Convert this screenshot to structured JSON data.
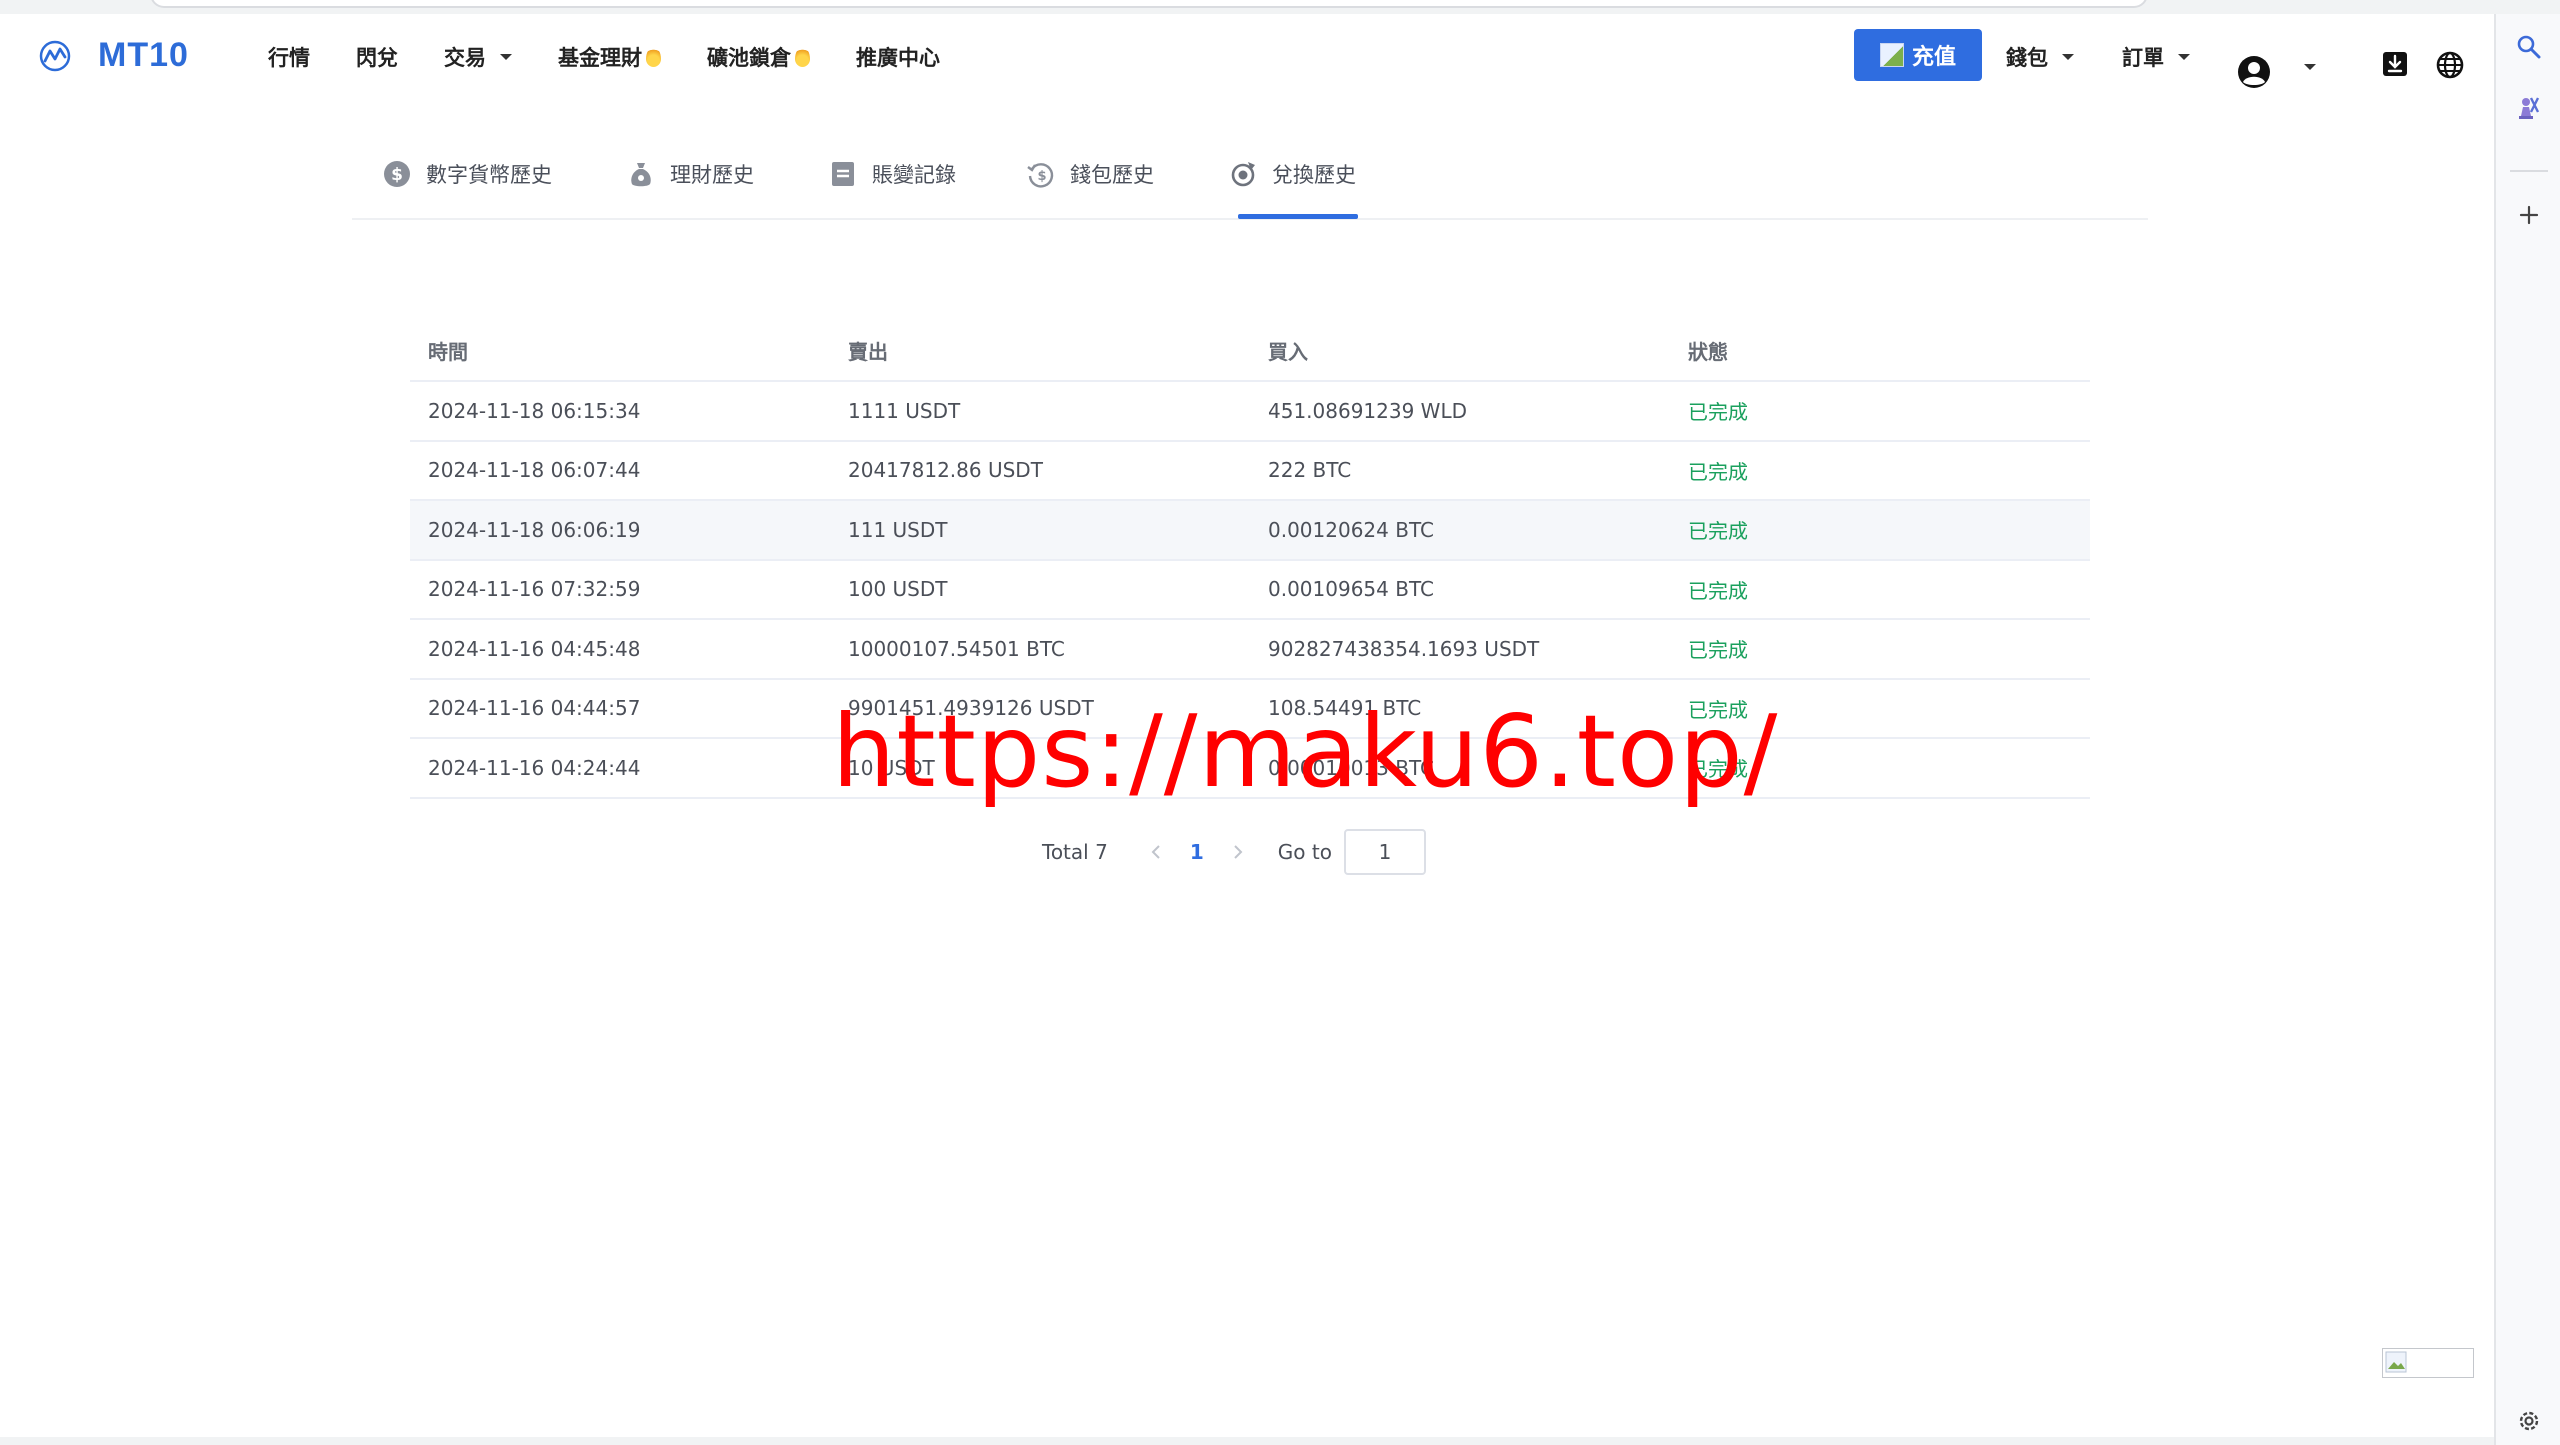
{
  "header": {
    "brand": "MT10",
    "nav": [
      {
        "label": "行情",
        "caret": false,
        "fire": false
      },
      {
        "label": "閃兌",
        "caret": false,
        "fire": false
      },
      {
        "label": "交易",
        "caret": true,
        "fire": false
      },
      {
        "label": "基金理財",
        "caret": false,
        "fire": true
      },
      {
        "label": "礦池鎖倉",
        "caret": false,
        "fire": true
      },
      {
        "label": "推廣中心",
        "caret": false,
        "fire": false
      }
    ],
    "deposit_label": "充值",
    "wallet_label": "錢包",
    "orders_label": "訂單",
    "accent": "#2f6de0"
  },
  "tabs": [
    {
      "label": "數字貨幣歷史",
      "icon": "dollar-circle-icon",
      "active": false
    },
    {
      "label": "理財歷史",
      "icon": "money-bag-icon",
      "active": false
    },
    {
      "label": "賬變記錄",
      "icon": "ledger-icon",
      "active": false
    },
    {
      "label": "錢包歷史",
      "icon": "wallet-history-icon",
      "active": false
    },
    {
      "label": "兌換歷史",
      "icon": "exchange-icon",
      "active": true
    }
  ],
  "table": {
    "columns": [
      "時間",
      "賣出",
      "買入",
      "狀態"
    ],
    "rows": [
      {
        "time": "2024-11-18 06:15:34",
        "sell": "1111 USDT",
        "buy": "451.08691239 WLD",
        "status": "已完成"
      },
      {
        "time": "2024-11-18 06:07:44",
        "sell": "20417812.86 USDT",
        "buy": "222 BTC",
        "status": "已完成"
      },
      {
        "time": "2024-11-18 06:06:19",
        "sell": "111 USDT",
        "buy": "0.00120624 BTC",
        "status": "已完成"
      },
      {
        "time": "2024-11-16 07:32:59",
        "sell": "100 USDT",
        "buy": "0.00109654 BTC",
        "status": "已完成"
      },
      {
        "time": "2024-11-16 04:45:48",
        "sell": "10000107.54501 BTC",
        "buy": "902827438354.1693 USDT",
        "status": "已完成"
      },
      {
        "time": "2024-11-16 04:44:57",
        "sell": "9901451.4939126 USDT",
        "buy": "108.54491 BTC",
        "status": "已完成"
      },
      {
        "time": "2024-11-16 04:24:44",
        "sell": "10 USDT",
        "buy": "0.00010013 BTC",
        "status": "已完成"
      }
    ],
    "status_color": "#1aa05d"
  },
  "pagination": {
    "total_label": "Total 7",
    "current_page": "1",
    "goto_label": "Go to",
    "goto_value": "1"
  },
  "watermark": "https://maku6.top/"
}
